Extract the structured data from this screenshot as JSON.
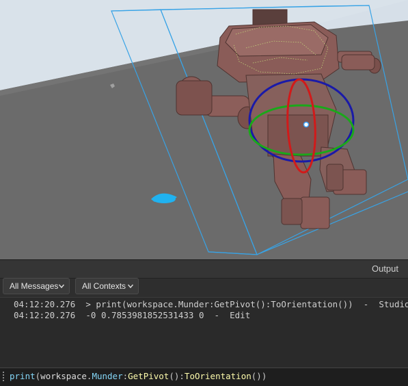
{
  "output_panel": {
    "title": "Output",
    "message_filter": "All Messages",
    "context_filter": "All Contexts",
    "log": [
      {
        "time": "04:12:20.276",
        "text": "> print(workspace.Munder:GetPivot():ToOrientation())",
        "sep": "-",
        "context": "Studio"
      },
      {
        "time": "04:12:20.276",
        "text": "-0 0.7853981852531433 0",
        "sep": "-",
        "context": "Edit"
      }
    ],
    "command_bar": {
      "parts": [
        "print",
        "(",
        "workspace",
        ".",
        "Munder",
        ":",
        "GetPivot",
        "():",
        "ToOrientation",
        "())"
      ]
    }
  },
  "colors": {
    "viewport_floor": "#6b6b6b",
    "sky": "#d6dfe8",
    "selection_box": "#38a3e6",
    "rotate_x": "#d11a1a",
    "rotate_y": "#1aa81a",
    "rotate_z": "#1a1aa8",
    "mech_body": "#8c5e5a",
    "spawn_marker": "#20b2f0"
  },
  "icons": [
    "chevron-down-icon",
    "rotate-gizmo",
    "spawn-location-icon"
  ]
}
